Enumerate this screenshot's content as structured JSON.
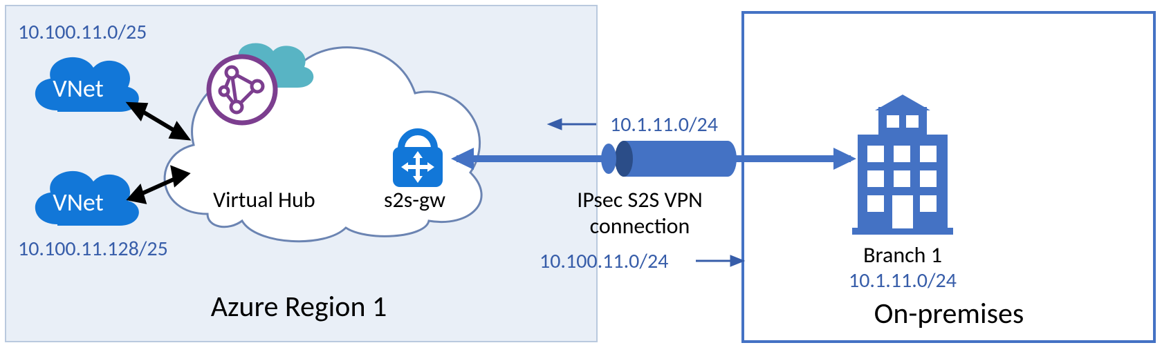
{
  "azure": {
    "region_label": "Azure Region 1",
    "vnet1": {
      "label": "VNet",
      "cidr": "10.100.11.0/25"
    },
    "vnet2": {
      "label": "VNet",
      "cidr": "10.100.11.128/25"
    },
    "hub_label": "Virtual Hub",
    "gateway_label": "s2s-gw"
  },
  "vpn": {
    "label_line1": "IPsec S2S VPN",
    "label_line2": "connection",
    "route_to_azure": "10.1.11.0/24",
    "route_to_onprem": "10.100.11.0/24"
  },
  "onprem": {
    "region_label": "On-premises",
    "branch_label": "Branch 1",
    "branch_cidr": "10.1.11.0/24"
  },
  "colors": {
    "azure_blue": "#1277d8",
    "teal_cloud": "#58b4c4",
    "globe_purple": "#7c3e8f",
    "box_border_azure": "#b9c9de",
    "box_fill_azure": "#e9eff7",
    "box_border_onprem": "#4472c4",
    "text_blue": "#375da9",
    "vpn_tube": "#4472c4"
  }
}
